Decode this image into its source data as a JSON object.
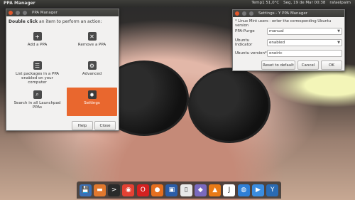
{
  "top_panel": {
    "app_name": "PPA Manager",
    "temperature": "Temp1 51,0°C",
    "clock": "Seg, 19 de Mar 00:38",
    "user": "rafaelpalm"
  },
  "main_window": {
    "title": "PPA Manager",
    "instruction_bold": "Double click",
    "instruction_rest": " an item to perform an action:",
    "tiles": [
      {
        "label": "Add a PPA",
        "icon": "plus-icon"
      },
      {
        "label": "Remove a PPA",
        "icon": "x-icon"
      },
      {
        "label": "List packages in a PPA enabled on your computer",
        "icon": "list-icon"
      },
      {
        "label": "Advanced",
        "icon": "wrench-icon"
      },
      {
        "label": "Search in all Launchpad PPAs",
        "icon": "search-icon"
      },
      {
        "label": "Settings",
        "icon": "gear-icon"
      }
    ],
    "help_label": "Help",
    "close_label": "Close"
  },
  "settings_window": {
    "title": "Settings - Y PPA Manager",
    "note": "* Linux Mint users - enter the corresponding Ubuntu version",
    "ppa_purge_label": "PPA-Purge",
    "ppa_purge_value": "manual",
    "indicator_label": "Ubuntu Indicator",
    "indicator_value": "enabled",
    "version_label": "Ubuntu version*",
    "version_value": "oneiric",
    "reset_label": "Reset to default",
    "cancel_label": "Cancel",
    "ok_label": "OK"
  },
  "dock": [
    {
      "name": "save-icon",
      "color": "#3a6fb5",
      "glyph": "💾"
    },
    {
      "name": "folder-icon",
      "color": "#e1782e",
      "glyph": "▬"
    },
    {
      "name": "terminal-icon",
      "color": "#2a2a2a",
      "glyph": ">"
    },
    {
      "name": "chrome-icon",
      "color": "#e34133",
      "glyph": "◉"
    },
    {
      "name": "opera-icon",
      "color": "#d42020",
      "glyph": "O"
    },
    {
      "name": "firefox-icon",
      "color": "#e66f1f",
      "glyph": "●"
    },
    {
      "name": "virtualbox-icon",
      "color": "#2b5da8",
      "glyph": "▣"
    },
    {
      "name": "document-icon",
      "color": "#e8e8e8",
      "glyph": "▯"
    },
    {
      "name": "cube-icon",
      "color": "#7a6abf",
      "glyph": "◆"
    },
    {
      "name": "vlc-icon",
      "color": "#e87a17",
      "glyph": "▲"
    },
    {
      "name": "java-icon",
      "color": "#ffffff",
      "glyph": "J"
    },
    {
      "name": "globe-icon",
      "color": "#2f7fd6",
      "glyph": "◍"
    },
    {
      "name": "play-icon",
      "color": "#3b8de0",
      "glyph": "▶"
    },
    {
      "name": "ppa-manager-icon",
      "color": "#2a6bb3",
      "glyph": "Y"
    }
  ]
}
